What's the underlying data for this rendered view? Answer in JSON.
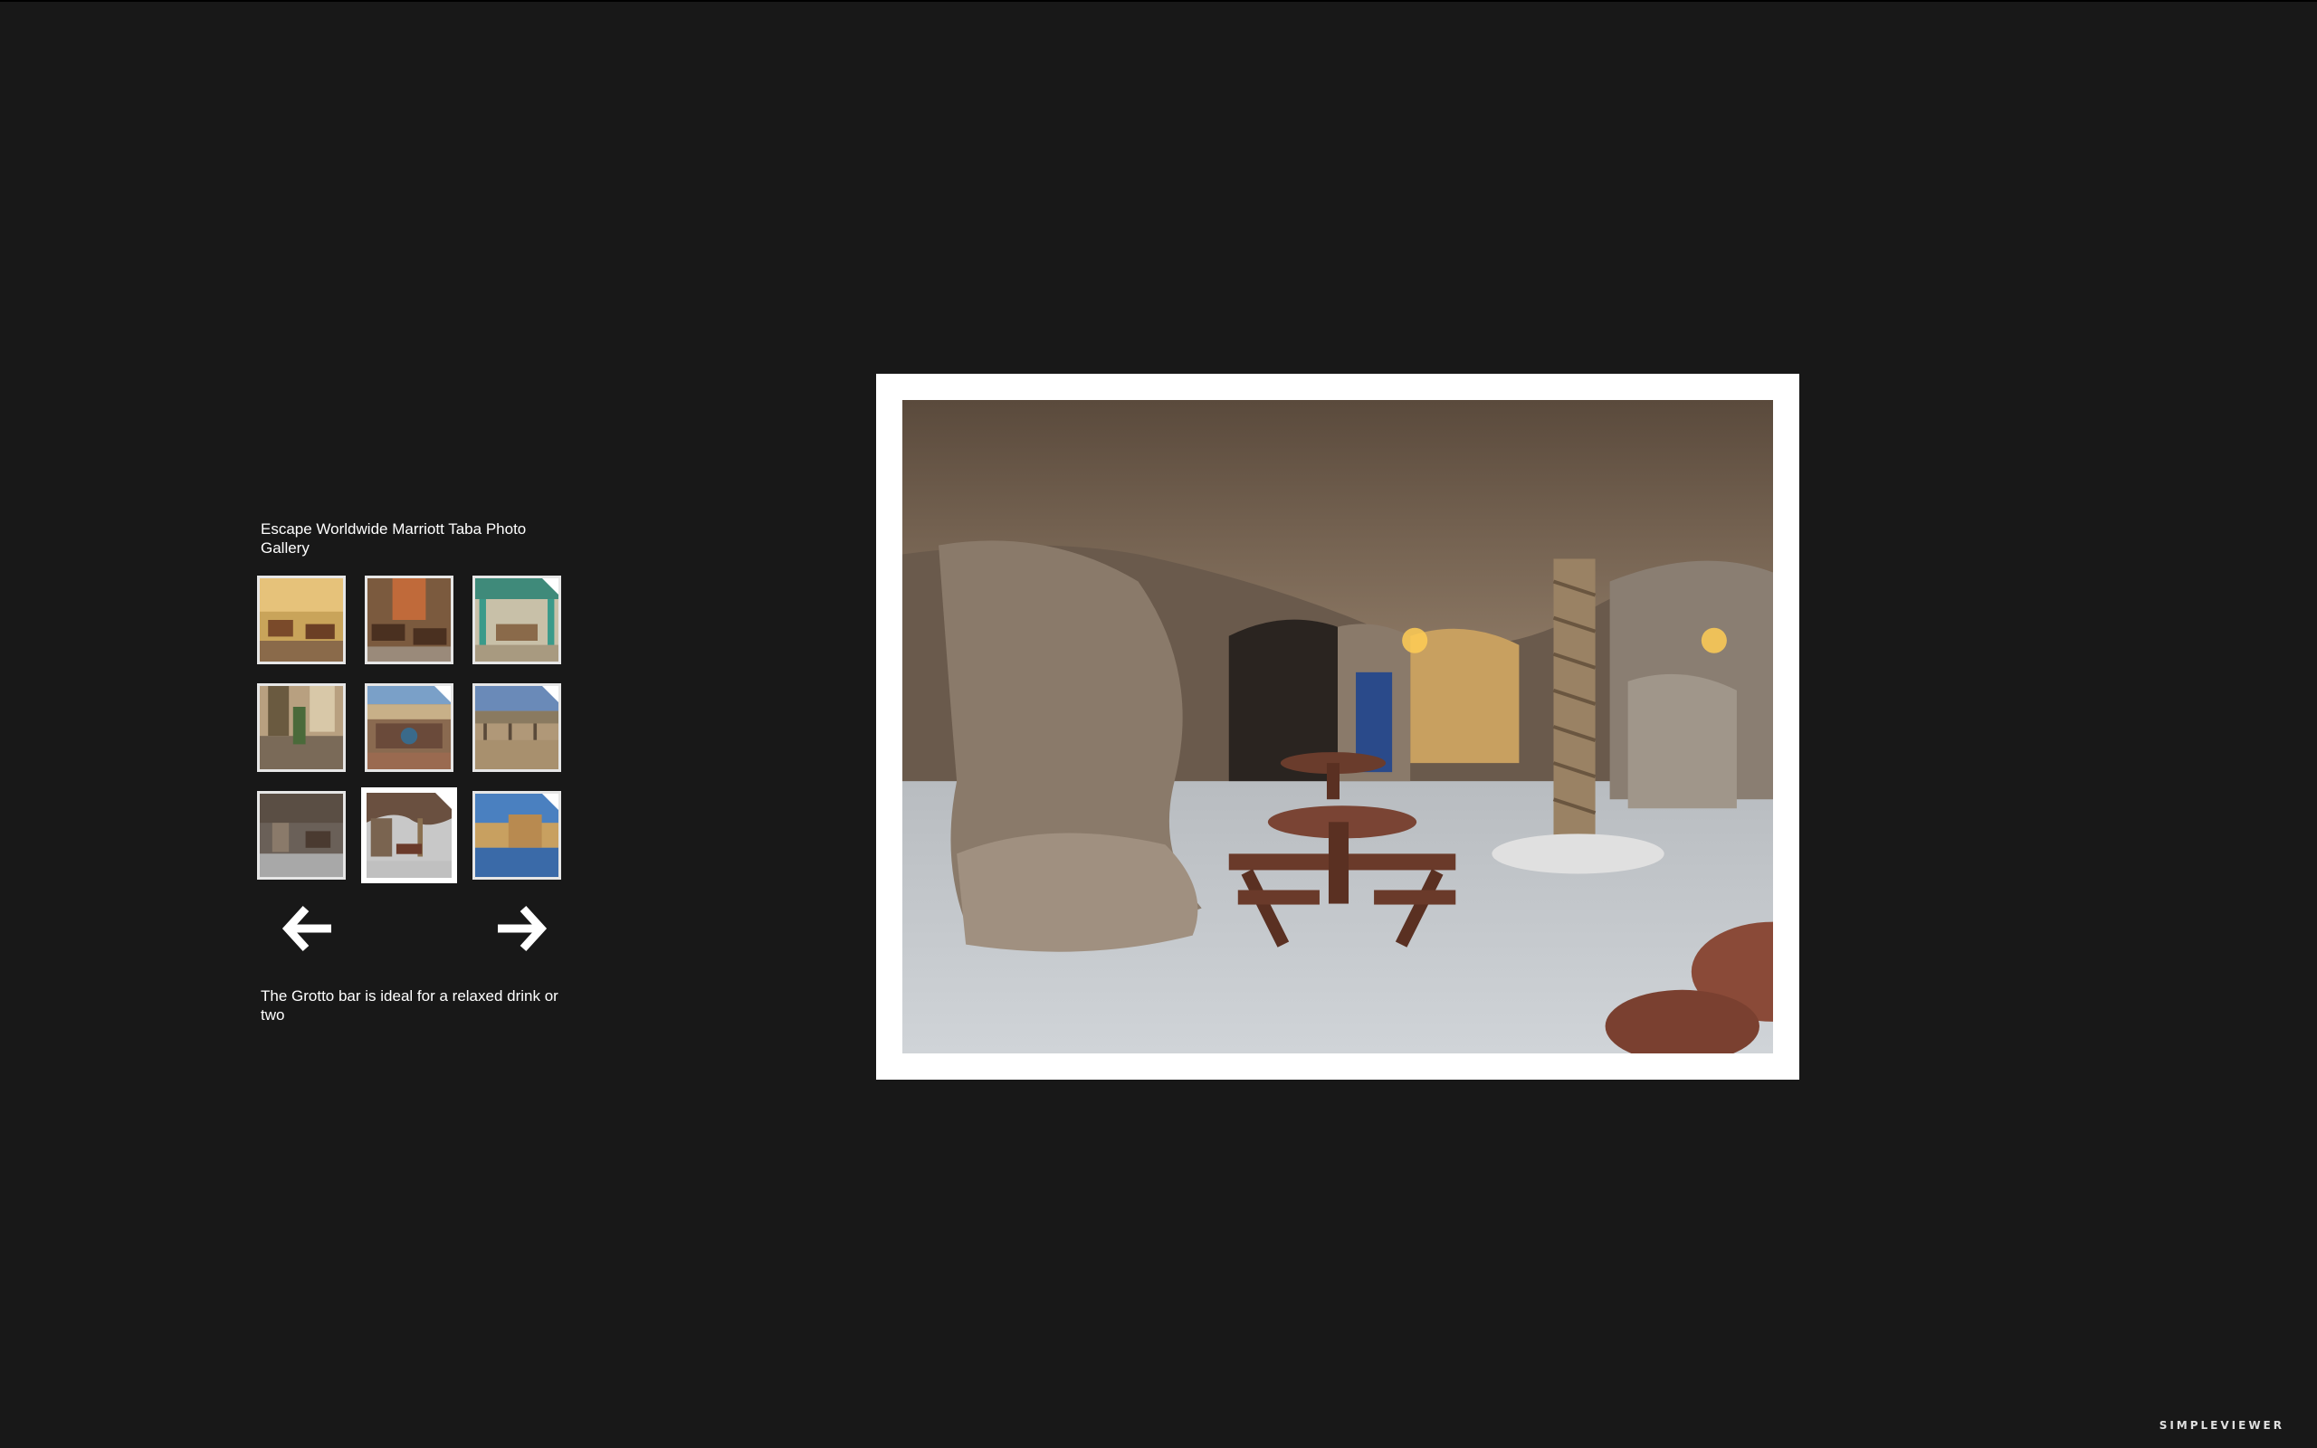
{
  "gallery": {
    "title": "Escape Worldwide Marriott Taba Photo Gallery",
    "caption": "The Grotto bar is ideal for a relaxed drink or two",
    "selected_index": 7
  },
  "thumbnails": [
    {
      "name": "thumb-restaurant-interior",
      "icon": "image-thumbnail"
    },
    {
      "name": "thumb-dining-terrace",
      "icon": "image-thumbnail"
    },
    {
      "name": "thumb-pool-cabana",
      "icon": "image-thumbnail"
    },
    {
      "name": "thumb-lobby",
      "icon": "image-thumbnail"
    },
    {
      "name": "thumb-garden-aerial",
      "icon": "image-thumbnail"
    },
    {
      "name": "thumb-courtyard-pergola",
      "icon": "image-thumbnail"
    },
    {
      "name": "thumb-grotto-bar",
      "icon": "image-thumbnail"
    },
    {
      "name": "thumb-grotto-seating",
      "icon": "image-thumbnail"
    },
    {
      "name": "thumb-pool-building",
      "icon": "image-thumbnail"
    }
  ],
  "navigation": {
    "prev_icon": "arrow-left-icon",
    "next_icon": "arrow-right-icon"
  },
  "branding": {
    "label": "SIMPLEVIEWER"
  },
  "colors": {
    "background": "#181818",
    "frame": "#ffffff",
    "text": "#ffffff"
  }
}
